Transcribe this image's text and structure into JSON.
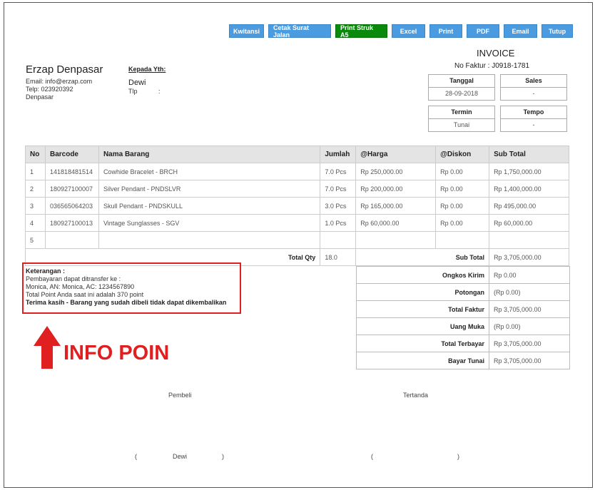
{
  "toolbar": {
    "kwitansi": "Kwitansi",
    "cetak_surat_jalan": "Cetak Surat Jalan",
    "print_struk": "Print Struk A5",
    "excel": "Excel",
    "print": "Print",
    "pdf": "PDF",
    "email": "Email",
    "tutup": "Tutup"
  },
  "company": {
    "name": "Erzap Denpasar",
    "email": "Email: info@erzap.com",
    "telp": "Telp: 023920392",
    "city": "Denpasar"
  },
  "customer": {
    "label": "Kepada Yth:",
    "name": "Dewi",
    "tlp_label": "Tlp",
    "tlp_sep": ":"
  },
  "invoice": {
    "title": "INVOICE",
    "no": "No Faktur : J0918-1781",
    "tanggal_label": "Tanggal",
    "tanggal": "28-09-2018",
    "sales_label": "Sales",
    "sales": "-",
    "termin_label": "Termin",
    "termin": "Tunai",
    "tempo_label": "Tempo",
    "tempo": "-"
  },
  "table": {
    "headers": [
      "No",
      "Barcode",
      "Nama Barang",
      "Jumlah",
      "@Harga",
      "@Diskon",
      "Sub Total"
    ],
    "rows": [
      [
        "1",
        "141818481514",
        "Cowhide Bracelet - BRCH",
        "7.0 Pcs",
        "Rp 250,000.00",
        "Rp 0.00",
        "Rp 1,750,000.00"
      ],
      [
        "2",
        "180927100007",
        "Silver Pendant - PNDSLVR",
        "7.0 Pcs",
        "Rp 200,000.00",
        "Rp 0.00",
        "Rp 1,400,000.00"
      ],
      [
        "3",
        "036565064203",
        "Skull Pendant - PNDSKULL",
        "3.0 Pcs",
        "Rp 165,000.00",
        "Rp 0.00",
        "Rp 495,000.00"
      ],
      [
        "4",
        "180927100013",
        "Vintage Sunglasses - SGV",
        "1.0 Pcs",
        "Rp 60,000.00",
        "Rp 0.00",
        "Rp 60,000.00"
      ],
      [
        "5",
        "",
        "",
        "",
        "",
        "",
        ""
      ]
    ],
    "total_qty_label": "Total Qty",
    "total_qty": "18.0",
    "sub_total_label": "Sub Total",
    "sub_total": "Rp 3,705,000.00"
  },
  "summary": [
    {
      "label": "Ongkos Kirim",
      "value": "Rp 0.00"
    },
    {
      "label": "Potongan",
      "value": "(Rp 0.00)"
    },
    {
      "label": "Total Faktur",
      "value": "Rp 3,705,000.00"
    },
    {
      "label": "Uang Muka",
      "value": "(Rp 0.00)"
    },
    {
      "label": "Total Terbayar",
      "value": "Rp 3,705,000.00"
    },
    {
      "label": "Bayar Tunai",
      "value": "Rp 3,705,000.00"
    }
  ],
  "keterangan": {
    "title": "Keterangan :",
    "line1": "Pembayaran dapat ditransfer ke :",
    "line2": "Monica, AN: Monica, AC: 1234567890",
    "line3": "Total Point Anda saat ini adalah 370 point",
    "line4": "Terima kasih - Barang yang sudah dibeli tidak dapat dikembalikan"
  },
  "annotation": {
    "label": "INFO POIN",
    "color": "#e02020"
  },
  "signature": {
    "pembeli": "Pembeli",
    "tertanda": "Tertanda",
    "open_paren": "(",
    "close_paren": ")",
    "buyer_name": "Dewi"
  }
}
